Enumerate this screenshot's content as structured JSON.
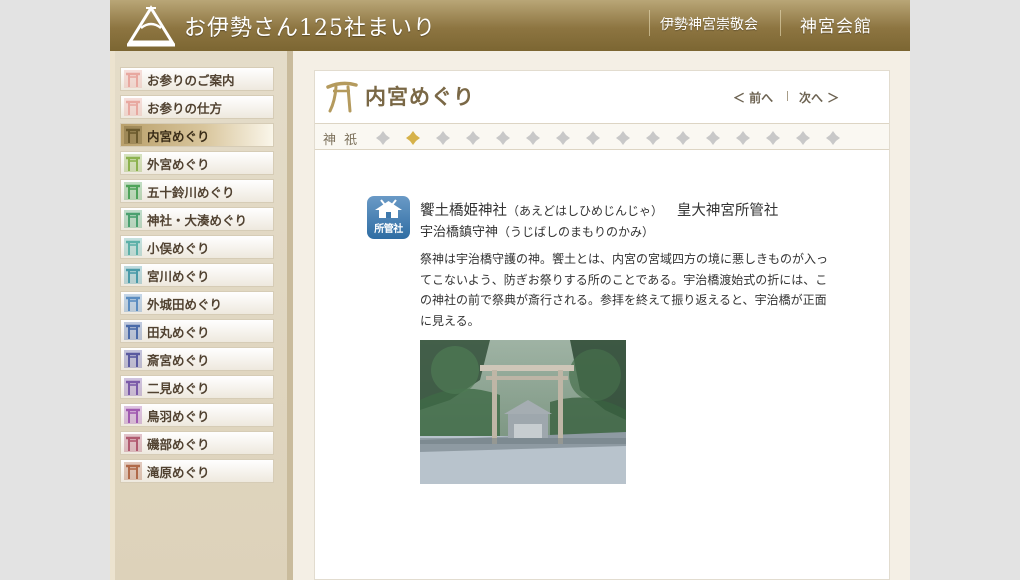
{
  "header": {
    "site_title": "お伊勢さん125社まいり",
    "links": [
      "伊勢神宮崇敬会",
      "神宮会館"
    ]
  },
  "sidebar": {
    "items": [
      {
        "label": "お参りのご案内",
        "color": "#e8a8a0",
        "active": false
      },
      {
        "label": "お参りの仕方",
        "color": "#e8a8a0",
        "active": false
      },
      {
        "label": "内宮めぐり",
        "color": "#6b5a2e",
        "active": true
      },
      {
        "label": "外宮めぐり",
        "color": "#8cb24e",
        "active": false
      },
      {
        "label": "五十鈴川めぐり",
        "color": "#4fa35a",
        "active": false
      },
      {
        "label": "神社・大湊めぐり",
        "color": "#4aa070",
        "active": false
      },
      {
        "label": "小俣めぐり",
        "color": "#5cb0a8",
        "active": false
      },
      {
        "label": "宮川めぐり",
        "color": "#4a9aa8",
        "active": false
      },
      {
        "label": "外城田めぐり",
        "color": "#5a8cc0",
        "active": false
      },
      {
        "label": "田丸めぐり",
        "color": "#4a6aa8",
        "active": false
      },
      {
        "label": "斎宮めぐり",
        "color": "#5a5aa0",
        "active": false
      },
      {
        "label": "二見めぐり",
        "color": "#7a5aa8",
        "active": false
      },
      {
        "label": "鳥羽めぐり",
        "color": "#a05ab0",
        "active": false
      },
      {
        "label": "磯部めぐり",
        "color": "#b05a70",
        "active": false
      },
      {
        "label": "滝原めぐり",
        "color": "#b06a4a",
        "active": false
      }
    ]
  },
  "main": {
    "title": "内宮めぐり",
    "prev_label": "＜ 前へ",
    "next_label": "次へ ＞",
    "subnav_label": "神 祇",
    "subnav_count": 16,
    "subnav_active_index": 1,
    "badge_label": "所管社",
    "shrine": {
      "name": "饗土橋姫神社",
      "reading": "（あえどはしひめじんじゃ）",
      "affiliation": "皇大神宮所管社",
      "deity": "宇治橋鎮守神",
      "deity_reading": "（うじばしのまもりのかみ）",
      "description": "祭神は宇治橋守護の神。饗土とは、内宮の宮域四方の境に悪しきものが入ってこないよう、防ぎお祭りする所のことである。宇治橋渡始式の折には、この神社の前で祭典が斎行される。参拝を終えて振り返えると、宇治橋が正面に見える。"
    }
  },
  "colors": {
    "header_gold": "#8d7541",
    "badge_blue": "#2f6da3",
    "diamond_active": "#d6b24a",
    "diamond_inactive": "#c8c8c8"
  }
}
